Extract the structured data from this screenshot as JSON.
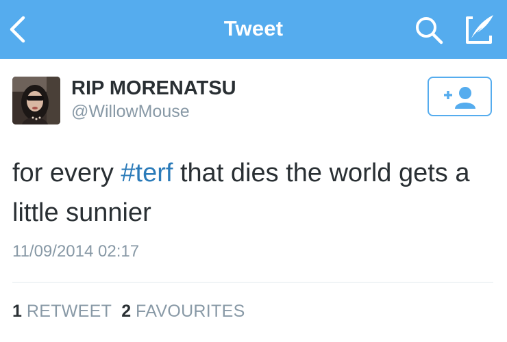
{
  "nav": {
    "title": "Tweet",
    "back_icon": "chevron-left-icon",
    "search_icon": "search-icon",
    "compose_icon": "compose-tweet-icon",
    "background_color": "#55acee"
  },
  "tweet": {
    "user": {
      "name": "RIP MORENATSU",
      "handle": "@WillowMouse",
      "avatar": "user-avatar-photo"
    },
    "follow_button_icon": "follow-user-icon",
    "text_parts": {
      "before": "for every ",
      "hashtag": "#terf",
      "after": " that dies the world gets a little sunnier"
    },
    "timestamp": "11/09/2014 02:17",
    "stats": {
      "retweets_count": "1",
      "retweets_label": "RETWEET",
      "favourites_count": "2",
      "favourites_label": "FAVOURITES"
    }
  },
  "colors": {
    "accent": "#55acee",
    "hashtag": "#2b7bb9",
    "text": "#292f33",
    "muted": "#8899a6"
  }
}
